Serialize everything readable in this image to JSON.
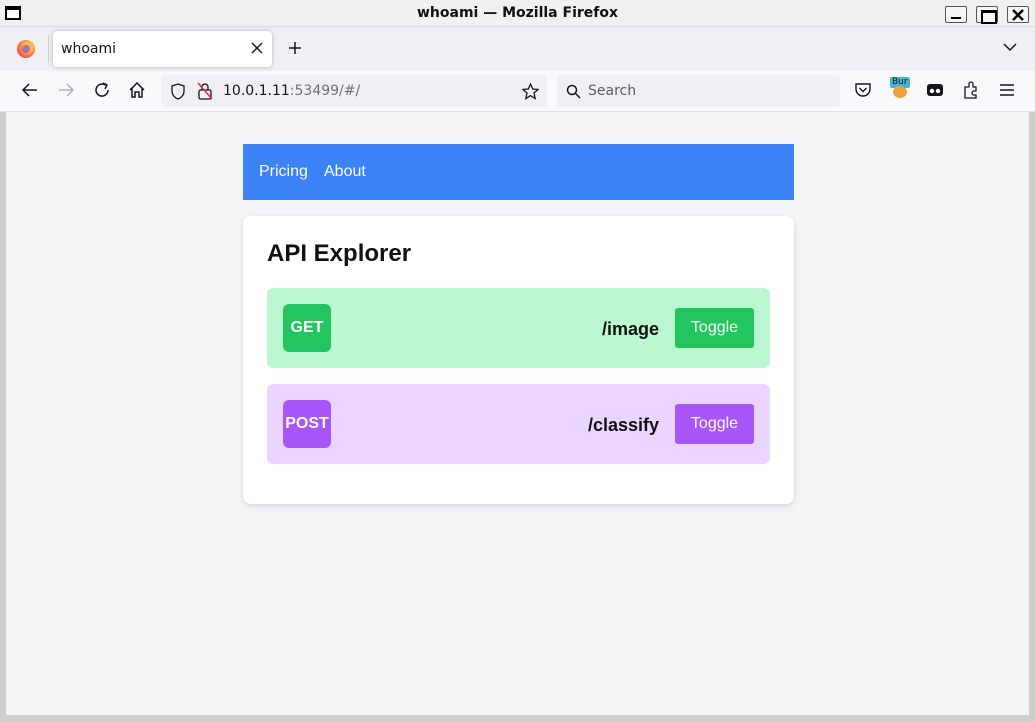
{
  "window": {
    "title": "whoami — Mozilla Firefox"
  },
  "tabs": [
    {
      "label": "whoami"
    }
  ],
  "urlbar": {
    "host": "10.0.1.11",
    "rest": ":53499/#/"
  },
  "searchbar": {
    "placeholder": "Search"
  },
  "extensions": {
    "bur_badge": "Bur"
  },
  "site_nav": {
    "items": [
      "Pricing",
      "About"
    ]
  },
  "explorer": {
    "title": "API Explorer",
    "endpoints": [
      {
        "method": "GET",
        "path": "/image",
        "toggle_label": "Toggle",
        "color": "#22c55e",
        "bg": "#bbf7d0"
      },
      {
        "method": "POST",
        "path": "/classify",
        "toggle_label": "Toggle",
        "color": "#a855f7",
        "bg": "#e9d5ff"
      }
    ]
  },
  "colors": {
    "nav_bg": "#3b82f6",
    "page_bg": "#f3f4f6"
  }
}
